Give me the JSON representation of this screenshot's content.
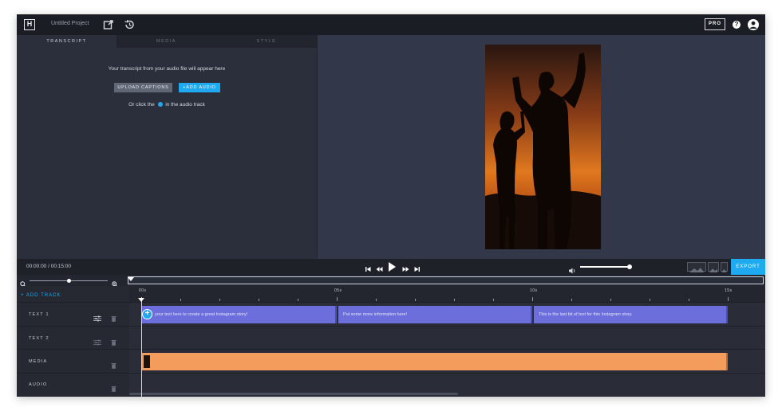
{
  "app": {
    "logo_letter": "H",
    "project_title": "Untitled Project",
    "pro_label": "PRO",
    "help_glyph": "?"
  },
  "icons": {
    "share": "share-icon",
    "history": "history-icon",
    "help": "help-icon",
    "account": "account-icon"
  },
  "left_panel": {
    "tabs": [
      {
        "label": "TRANSCRIPT",
        "active": true
      },
      {
        "label": "MEDIA",
        "active": false
      },
      {
        "label": "STYLE",
        "active": false
      }
    ],
    "message": "Your transcript from your audio file will appear here",
    "upload_label": "UPLOAD CAPTIONS",
    "add_audio_label": "+ADD AUDIO",
    "hint_before": "Or click the",
    "hint_after": "in the audio track"
  },
  "controls": {
    "timecode": "00:00:00 / 00:15:00",
    "volume_level": 0.97,
    "export_label": "EXPORT"
  },
  "zoom": {
    "level": 0.5
  },
  "timeline": {
    "add_track_label": "+ ADD TRACK",
    "ruler_labels": [
      "00s",
      "05s",
      "10s",
      "15s"
    ],
    "tracks": [
      {
        "label": "TEXT 1"
      },
      {
        "label": "TEXT 2"
      },
      {
        "label": "MEDIA"
      },
      {
        "label": "AUDIO"
      }
    ],
    "text_clips": [
      "your text here to create a great Instagram story!",
      "Put some more information here!",
      "This is the last bit of text for this Instagram story."
    ],
    "add_glyph": "+"
  },
  "colors": {
    "accent": "#1ea9f0",
    "text_clip": "#6c6fdb",
    "media_clip": "#f39c5c",
    "background": "#2a2e3a"
  }
}
